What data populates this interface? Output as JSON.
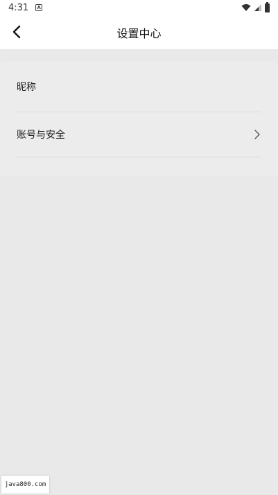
{
  "status_bar": {
    "time": "4:31",
    "notification_icon": "a-box-icon",
    "icons": [
      "wifi-icon",
      "signal-icon",
      "battery-icon"
    ]
  },
  "app_bar": {
    "title": "设置中心",
    "back_icon": "chevron-left-icon"
  },
  "settings": {
    "items": [
      {
        "label": "昵称",
        "has_chevron": false
      },
      {
        "label": "账号与安全",
        "has_chevron": true
      }
    ]
  },
  "watermark": {
    "text": "java800.com"
  },
  "colors": {
    "background": "#e9e9e9",
    "bar": "#ffffff",
    "card": "#ececec",
    "divider": "#d9d9d9"
  }
}
